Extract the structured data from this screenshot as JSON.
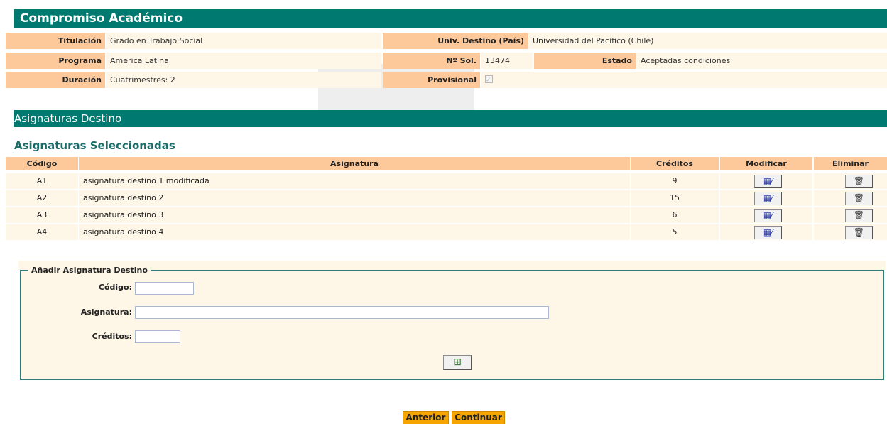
{
  "header": {
    "title": "Compromiso Académico"
  },
  "info": {
    "titulacion_label": "Titulación",
    "titulacion_value": "Grado en Trabajo Social",
    "univ_label": "Univ. Destino (País)",
    "univ_value": "Universidad del Pacífico (Chile)",
    "programa_label": "Programa",
    "programa_value": "America Latina",
    "nsol_label": "Nº Sol.",
    "nsol_value": "13474",
    "estado_label": "Estado",
    "estado_value": "Aceptadas condiciones",
    "duracion_label": "Duración",
    "duracion_value": "Cuatrimestres: 2",
    "provisional_label": "Provisional",
    "provisional_checked": true
  },
  "section": {
    "title": "Asignaturas Destino",
    "subtitle": "Asignaturas Seleccionadas"
  },
  "table": {
    "columns": [
      "Código",
      "Asignatura",
      "Créditos",
      "Modificar",
      "Eliminar"
    ],
    "rows": [
      {
        "codigo": "A1",
        "asignatura": "asignatura destino 1 modificada",
        "creditos": "9"
      },
      {
        "codigo": "A2",
        "asignatura": "asignatura destino 2",
        "creditos": "15"
      },
      {
        "codigo": "A3",
        "asignatura": "asignatura destino 3",
        "creditos": "6"
      },
      {
        "codigo": "A4",
        "asignatura": "asignatura destino 4",
        "creditos": "5"
      }
    ],
    "edit_icon": "edit-icon",
    "delete_icon": "trash-icon"
  },
  "add_form": {
    "legend": "Añadir Asignatura Destino",
    "codigo_label": "Código:",
    "codigo_value": "",
    "asignatura_label": "Asignatura:",
    "asignatura_value": "",
    "creditos_label": "Créditos:",
    "creditos_value": "",
    "add_icon": "add-row-icon"
  },
  "nav": {
    "prev_label": "Anterior",
    "next_label": "Continuar"
  },
  "colors": {
    "header_teal": "#007a70",
    "label_orange": "#fdc99b",
    "value_cream": "#fef6e6",
    "button_orange": "#f5a400",
    "subtitle_teal": "#1a6e6a"
  }
}
